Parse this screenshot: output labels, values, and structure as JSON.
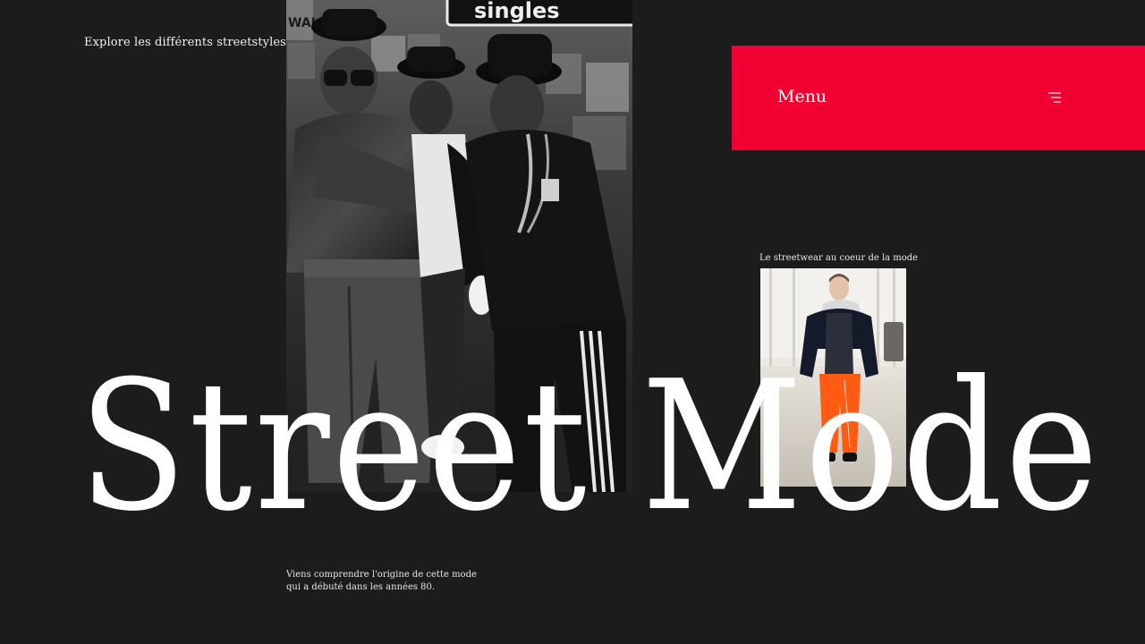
{
  "header": {
    "tagline": "Explore les différents streetstyles"
  },
  "menu": {
    "label": "Menu",
    "icon": "hamburger-icon",
    "accent_color": "#f20031"
  },
  "hero": {
    "headline": "Street Mode",
    "photo": "black-and-white-photo-three-men-in-hats-and-tracksuits",
    "sign_text": "singles",
    "sign_text_left": "WALK\nAHA"
  },
  "feature": {
    "caption": "Le streetwear au coeur de la mode",
    "photo": "runway-model-black-jacket-orange-pants"
  },
  "intro": {
    "line1": "Viens comprendre l'origine de cette mode",
    "line2": "qui a débuté dans les années 80."
  }
}
